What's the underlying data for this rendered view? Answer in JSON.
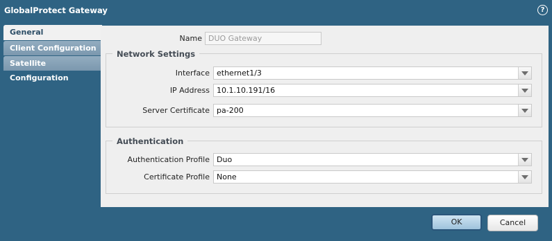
{
  "dialog": {
    "title": "GlobalProtect Gateway",
    "help_label": "?"
  },
  "tabs": [
    {
      "label": "General",
      "active": true
    },
    {
      "label": "Client Configuration",
      "active": false
    },
    {
      "label": "Satellite Configuration",
      "active": false
    }
  ],
  "general": {
    "name_label": "Name",
    "name_value": "DUO Gateway"
  },
  "network_settings": {
    "legend": "Network Settings",
    "interface_label": "Interface",
    "interface_value": "ethernet1/3",
    "ip_label": "IP Address",
    "ip_value": "10.1.10.191/16",
    "cert_label": "Server Certificate",
    "cert_value": "pa-200"
  },
  "authentication": {
    "legend": "Authentication",
    "auth_profile_label": "Authentication Profile",
    "auth_profile_value": "Duo",
    "cert_profile_label": "Certificate Profile",
    "cert_profile_value": "None"
  },
  "buttons": {
    "ok": "OK",
    "cancel": "Cancel"
  }
}
